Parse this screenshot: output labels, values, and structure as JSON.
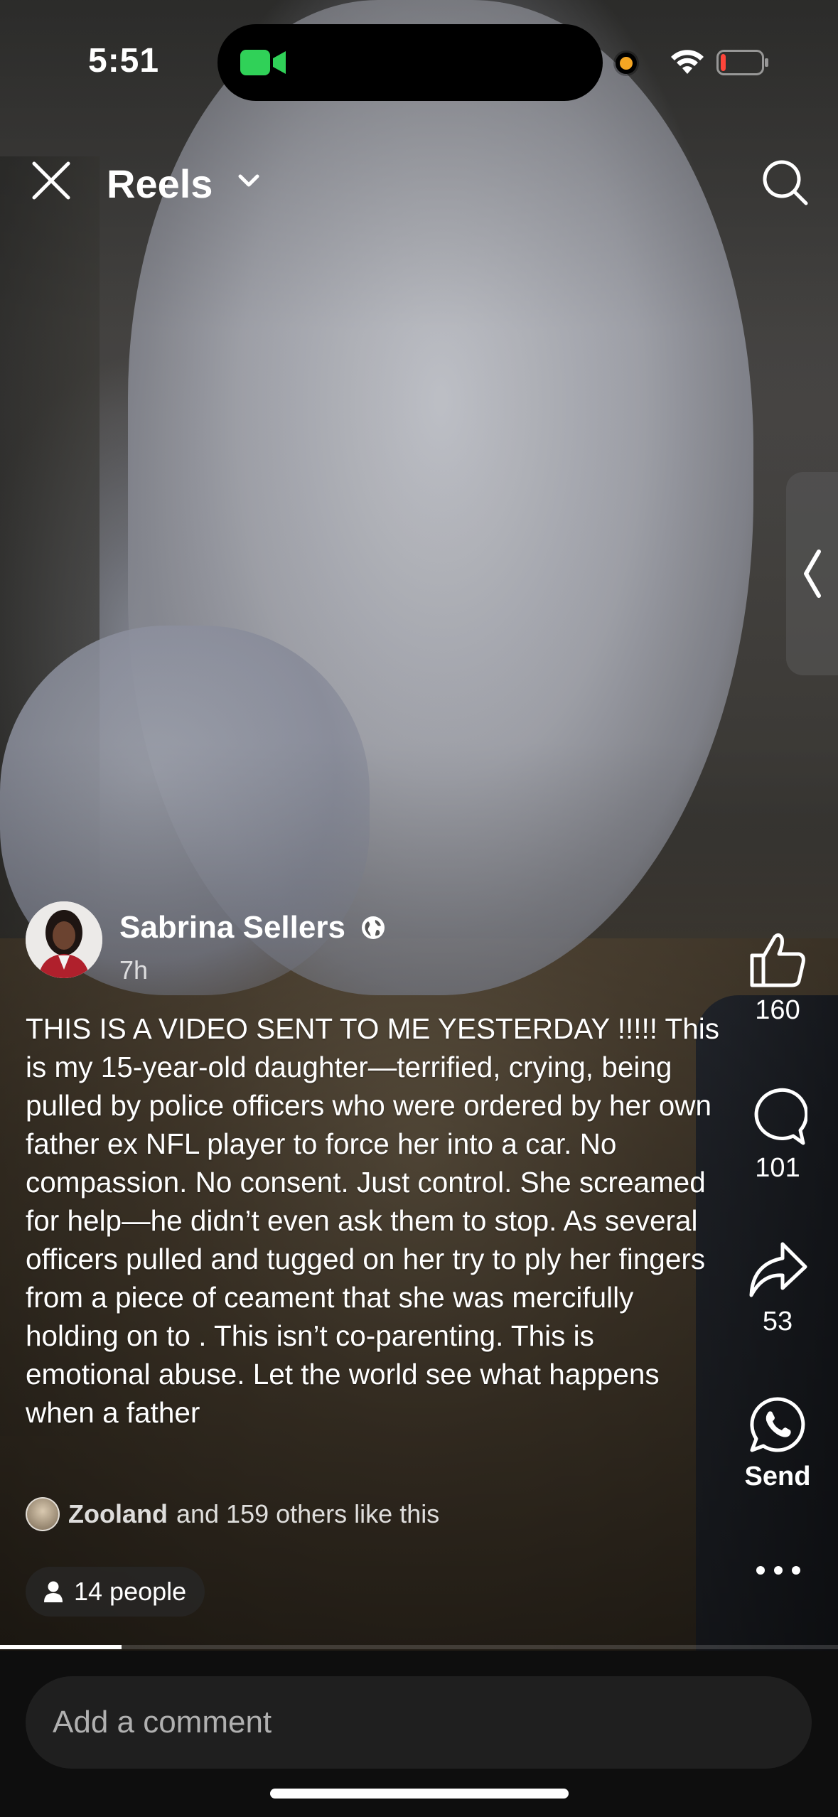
{
  "status_bar": {
    "time": "5:51",
    "camera_color": "#30d158",
    "privacy_dot_color": "#f5a623",
    "battery_color": "#ff453a",
    "battery_level": 0.12
  },
  "header": {
    "title": "Reels",
    "close_icon": "close-icon",
    "dropdown_icon": "chevron-down-icon",
    "search_icon": "search-icon"
  },
  "post": {
    "author": "Sabrina Sellers",
    "audience_icon": "globe-icon",
    "time": "7h",
    "caption": "THIS IS A VIDEO SENT TO ME YESTERDAY !!!!! This is my 15-year-old daughter—terrified, crying, being pulled by police officers who were ordered by her own father ex NFL player to force her into a car. No compassion. No consent. Just control. She screamed for help—he didn’t even ask them to stop. As several officers pulled and tugged on her try to ply her fingers from a piece of ceament that she was mercifully holding on to . This isn’t co-parenting. This is emotional abuse. Let the world see what happens when a father",
    "likes_name": "Zooland",
    "likes_rest": "and 159 others like this",
    "people_label": "14 people"
  },
  "actions": {
    "like_count": "160",
    "comment_count": "101",
    "share_count": "53",
    "send_label": "Send"
  },
  "progress": {
    "fraction": 0.145
  },
  "comment_box": {
    "placeholder": "Add a comment"
  }
}
